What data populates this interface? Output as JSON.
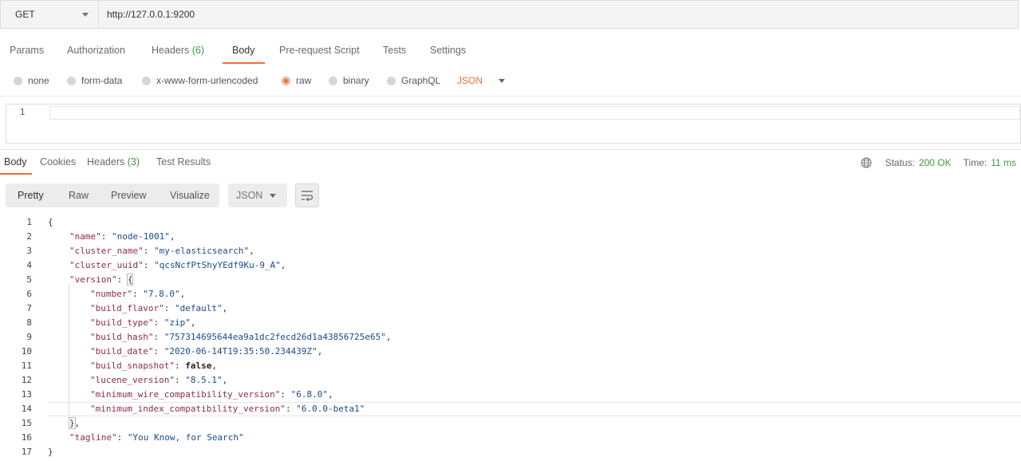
{
  "request": {
    "method": "GET",
    "url": "http://127.0.0.1:9200",
    "tabs": [
      {
        "label": "Params"
      },
      {
        "label": "Authorization"
      },
      {
        "label": "Headers",
        "count": "(6)"
      },
      {
        "label": "Body"
      },
      {
        "label": "Pre-request Script"
      },
      {
        "label": "Tests"
      },
      {
        "label": "Settings"
      }
    ],
    "active_tab": "Body",
    "body_types": [
      "none",
      "form-data",
      "x-www-form-urlencoded",
      "raw",
      "binary",
      "GraphQL"
    ],
    "selected_body_type": "raw",
    "raw_format": "JSON",
    "editor_line_number": "1"
  },
  "response": {
    "tabs": [
      {
        "label": "Body"
      },
      {
        "label": "Cookies"
      },
      {
        "label": "Headers",
        "count": "(3)"
      },
      {
        "label": "Test Results"
      }
    ],
    "active_tab": "Body",
    "status_label": "Status:",
    "status_value": "200 OK",
    "time_label": "Time:",
    "time_value": "11 ms",
    "view_modes": [
      "Pretty",
      "Raw",
      "Preview",
      "Visualize"
    ],
    "active_view_mode": "Pretty",
    "format": "JSON",
    "lines": [
      {
        "n": "1"
      },
      {
        "n": "2"
      },
      {
        "n": "3"
      },
      {
        "n": "4"
      },
      {
        "n": "5"
      },
      {
        "n": "6"
      },
      {
        "n": "7"
      },
      {
        "n": "8"
      },
      {
        "n": "9"
      },
      {
        "n": "10"
      },
      {
        "n": "11"
      },
      {
        "n": "12"
      },
      {
        "n": "13"
      },
      {
        "n": "14"
      },
      {
        "n": "15"
      },
      {
        "n": "16"
      },
      {
        "n": "17"
      }
    ],
    "json": {
      "name": "node-1001",
      "cluster_name": "my-elasticsearch",
      "cluster_uuid": "qcsNcfPtShyYEdf9Ku-9_A",
      "version_number": "7.8.0",
      "build_flavor": "default",
      "build_type": "zip",
      "build_hash": "757314695644ea9a1dc2fecd26d1a43856725e65",
      "build_date": "2020-06-14T19:35:50.234439Z",
      "build_snapshot": "false",
      "lucene_version": "8.5.1",
      "minimum_wire_compatibility_version": "6.8.0",
      "minimum_index_compatibility_version": "6.0.0-beta1",
      "tagline": "You Know, for Search"
    }
  },
  "colors": {
    "accent": "#f26b3a",
    "success": "#3f9b3c"
  }
}
